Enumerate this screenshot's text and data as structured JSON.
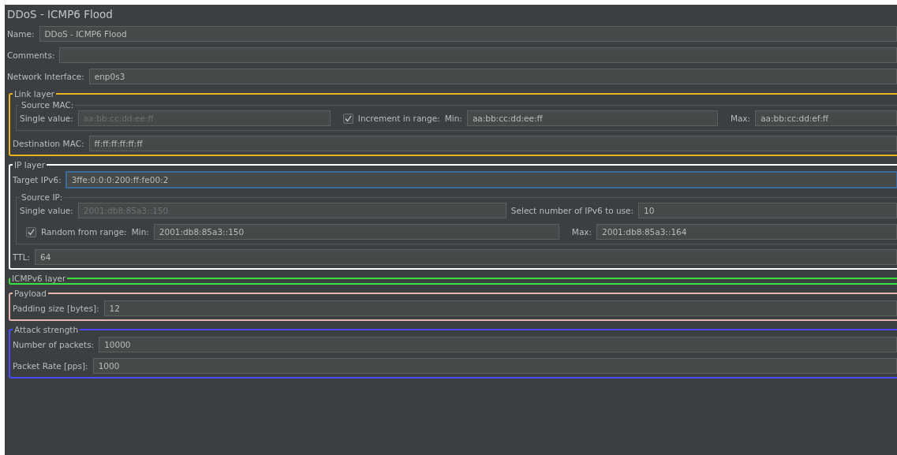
{
  "title": "DDoS - ICMP6 Flood",
  "fields": [
    {
      "label": "Name:",
      "value": "DDoS - ICMP6 Flood"
    },
    {
      "label": "Comments:"
    },
    {
      "label": "Network Interface:",
      "value": "enp0s3"
    }
  ],
  "link_layer": {
    "title": "Link layer",
    "color": "#e8b51e",
    "source_mac": {
      "title": "Source MAC:",
      "single_label": "Single value:",
      "single_value": "aa:bb:cc:dd:ee:ff",
      "single_disabled": true,
      "increment": {
        "label": "Increment in range:",
        "checked": true
      },
      "min_label": "Min:",
      "min_value": "aa:bb:cc:dd:ee:ff",
      "max_label": "Max:",
      "max_value": "aa:bb:cc:dd:ef:ff"
    },
    "destination": {
      "label": "Destination MAC:",
      "value": "ff:ff:ff:ff:ff:ff"
    }
  },
  "ip_layer": {
    "title": "IP layer",
    "color": "#ffffff",
    "target": {
      "label": "Target IPv6:",
      "value": "3ffe:0:0:0:200:ff:fe00:2",
      "focused": true
    },
    "source_ip": {
      "title": "Source IP:",
      "single_label": "Single value:",
      "single_value": "2001:db8:85a3::150",
      "single_disabled": true,
      "count_label": "Select number of IPv6 to use:",
      "count_value": "10",
      "random": {
        "label": "Random from range:",
        "checked": true
      },
      "min_label": "Min:",
      "min_value": "2001:db8:85a3::150",
      "max_label": "Max:",
      "max_value": "2001:db8:85a3::164"
    },
    "ttl": {
      "label": "TTL:",
      "value": "64"
    }
  },
  "icmp_layer": {
    "title": "ICMPv6 layer",
    "color": "#3ee03e"
  },
  "payload": {
    "title": "Payload",
    "color": "#e8b4b0",
    "fields": [
      {
        "label": "Padding size [bytes]:",
        "value": "12"
      }
    ]
  },
  "attack_strength": {
    "title": "Attack strength",
    "color": "#4a4aff",
    "fields": [
      {
        "label": "Number of packets:",
        "value": "10000"
      },
      {
        "label": "Packet Rate [pps]:",
        "value": "1000"
      }
    ]
  }
}
